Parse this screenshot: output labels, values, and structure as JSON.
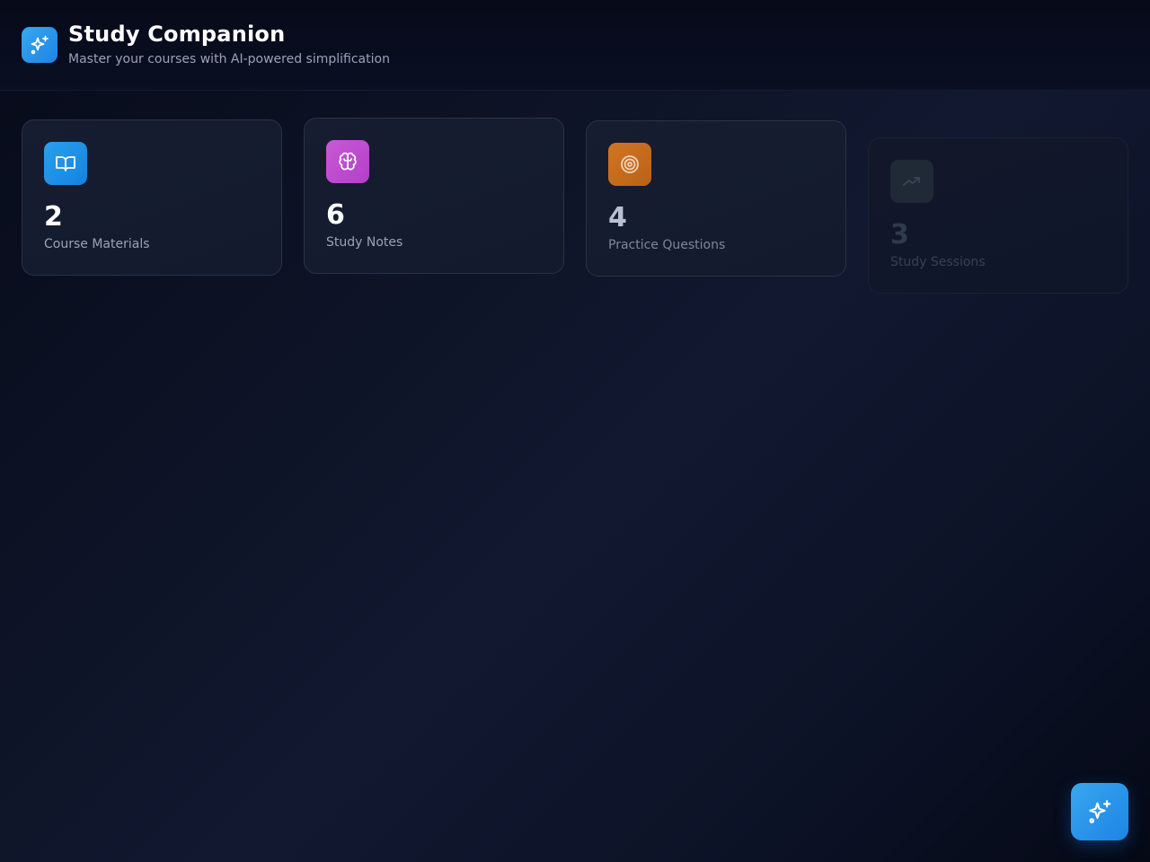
{
  "header": {
    "title": "Study Companion",
    "subtitle": "Master your courses with AI-powered simplification",
    "logo_icon": "sparkles-icon"
  },
  "stats": [
    {
      "value": "2",
      "label": "Course Materials",
      "icon": "book-open-icon",
      "color": "#1e90e8"
    },
    {
      "value": "6",
      "label": "Study Notes",
      "icon": "brain-icon",
      "color": "#c04dd0"
    },
    {
      "value": "4",
      "label": "Practice Questions",
      "icon": "target-icon",
      "color": "#c96a1c"
    },
    {
      "value": "3",
      "label": "Study Sessions",
      "icon": "trending-up-icon",
      "color": "#1f2a36"
    }
  ],
  "fab": {
    "icon": "sparkles-icon"
  },
  "colors": {
    "accent": "#2196f3",
    "background": "#0e1427"
  }
}
